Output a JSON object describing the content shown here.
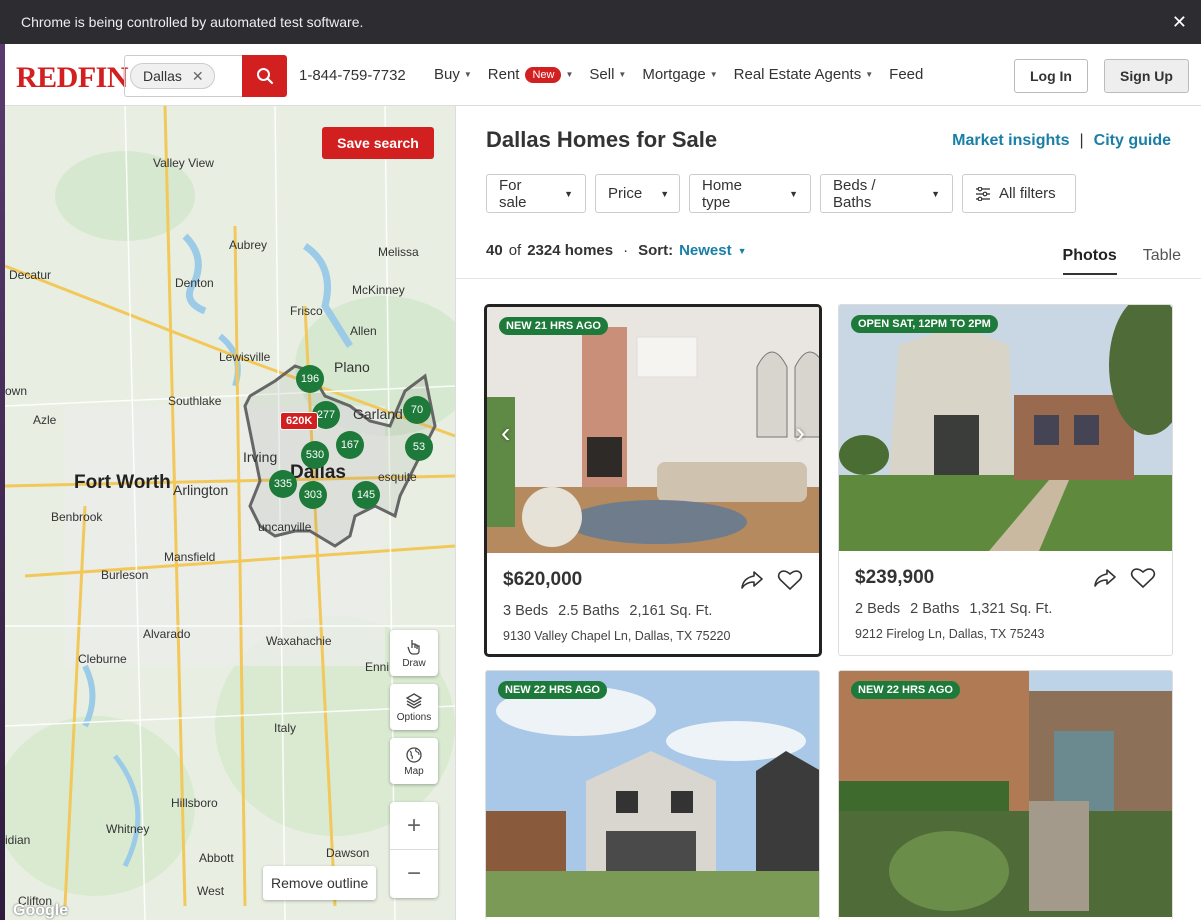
{
  "infobar": {
    "message": "Chrome is being controlled by automated test software.",
    "close": "✕"
  },
  "header": {
    "logo": "REDFIN",
    "search_chip": "Dallas",
    "phone": "1-844-759-7732",
    "nav": [
      {
        "label": "Buy"
      },
      {
        "label": "Rent",
        "badge": "New"
      },
      {
        "label": "Sell"
      },
      {
        "label": "Mortgage"
      },
      {
        "label": "Real Estate Agents"
      },
      {
        "label": "Feed"
      }
    ],
    "login": "Log In",
    "signup": "Sign Up"
  },
  "map": {
    "save_search": "Save search",
    "labels": {
      "valley_view": "Valley View",
      "aubrey": "Aubrey",
      "melissa": "Melissa",
      "decatur": "Decatur",
      "denton": "Denton",
      "mckinney": "McKinney",
      "frisco": "Frisco",
      "allen": "Allen",
      "lewisville": "Lewisville",
      "plano": "Plano",
      "southlake": "Southlake",
      "garland": "Garland",
      "azle": "Azle",
      "irving": "Irving",
      "dallas": "Dallas",
      "fort_worth": "Fort Worth",
      "arlington": "Arlington",
      "mesquite": "esquite",
      "benbrook": "Benbrook",
      "mansfield": "Mansfield",
      "burleson": "Burleson",
      "alvarado": "Alvarado",
      "waxahachie": "Waxahachie",
      "cleburne": "Cleburne",
      "ennis": "Enni",
      "italy": "Italy",
      "hillsboro": "Hillsboro",
      "whitney": "Whitney",
      "abbott": "Abbott",
      "dawson": "Dawson",
      "clifton": "Clifton",
      "west": "West",
      "meridian": "idian",
      "town": "own",
      "duncanville": "uncanville"
    },
    "clusters": [
      "196",
      "277",
      "167",
      "530",
      "335",
      "303",
      "145",
      "70",
      "53"
    ],
    "price_pin": "620K",
    "controls": {
      "draw": "Draw",
      "options": "Options",
      "map": "Map"
    },
    "zoom_in": "+",
    "zoom_out": "−",
    "remove_outline": "Remove outline",
    "attribution": "Google"
  },
  "results": {
    "title": "Dallas Homes for Sale",
    "market_insights": "Market insights",
    "separator": "|",
    "city_guide": "City guide",
    "filters": [
      "For sale",
      "Price",
      "Home type",
      "Beds / Baths",
      "All filters"
    ],
    "count_shown": "40",
    "count_of": "of",
    "count_total": "2324 homes",
    "sort_label": "Sort:",
    "sort_value": "Newest",
    "tabs": [
      "Photos",
      "Table"
    ],
    "listings": [
      {
        "tag": "NEW 21 HRS AGO",
        "price": "$620,000",
        "beds": "3 Beds",
        "baths": "2.5 Baths",
        "sqft": "2,161 Sq. Ft.",
        "address": "9130 Valley Chapel Ln, Dallas, TX 75220"
      },
      {
        "tag": "OPEN SAT, 12PM TO 2PM",
        "price": "$239,900",
        "beds": "2 Beds",
        "baths": "2 Baths",
        "sqft": "1,321 Sq. Ft.",
        "address": "9212 Firelog Ln, Dallas, TX 75243"
      },
      {
        "tag": "NEW 22 HRS AGO"
      },
      {
        "tag": "NEW 22 HRS AGO"
      }
    ]
  },
  "colors": {
    "brand": "#d21f1f",
    "link": "#1a7fa6",
    "cluster": "#1e7a3a"
  }
}
